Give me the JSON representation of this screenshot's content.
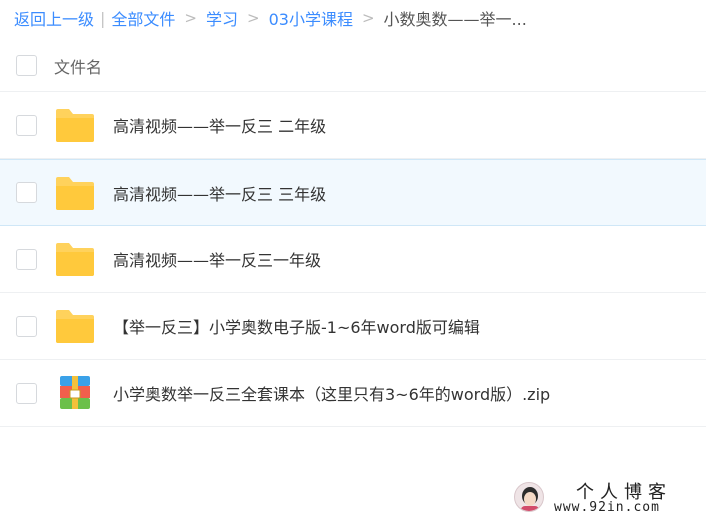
{
  "breadcrumb": {
    "back": "返回上一级",
    "all_files": "全部文件",
    "path": [
      "学习",
      "03小学课程"
    ],
    "current": "小数奥数——举一..."
  },
  "header": {
    "name_label": "文件名"
  },
  "files": [
    {
      "name": "高清视频——举一反三 二年级",
      "icon": "folder-icon",
      "hovered": false
    },
    {
      "name": "高清视频——举一反三 三年级",
      "icon": "folder-icon",
      "hovered": true
    },
    {
      "name": "高清视频——举一反三一年级",
      "icon": "folder-icon",
      "hovered": false
    },
    {
      "name": "【举一反三】小学奥数电子版-1~6年word版可编辑",
      "icon": "folder-icon",
      "hovered": false
    },
    {
      "name": "小学奥数举一反三全套课本（这里只有3~6年的word版）.zip",
      "icon": "zip-archive-icon",
      "hovered": false
    }
  ],
  "watermark": {
    "title": "个人博客",
    "url": "www.92in.com"
  },
  "colors": {
    "link": "#3b8cff",
    "folder": "#ffd25c",
    "hover_bg": "#f2f9fe"
  }
}
